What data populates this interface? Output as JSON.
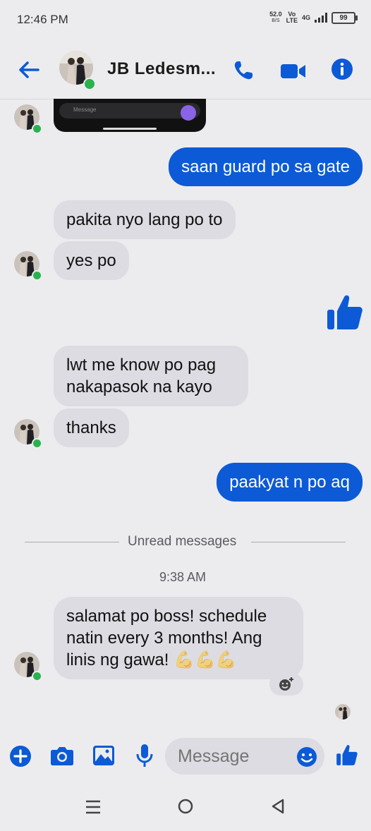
{
  "status_bar": {
    "time": "12:46 PM",
    "speed_value": "52.0",
    "speed_unit": "B/S",
    "volte_top": "Vo",
    "volte_bottom": "LTE",
    "network": "4G",
    "battery": "99"
  },
  "header": {
    "contact_name": "JB Ledesm...",
    "accent_color": "#0c5ad6"
  },
  "image_message": {
    "placeholder": "Message"
  },
  "messages": [
    {
      "direction": "out",
      "text": "saan guard po sa gate"
    },
    {
      "direction": "in",
      "text": "pakita nyo lang po to"
    },
    {
      "direction": "in",
      "text": "yes po"
    },
    {
      "direction": "out",
      "type": "like",
      "icon": "thumbs-up-icon"
    },
    {
      "direction": "in",
      "text": "lwt me know po pag nakapasok na kayo"
    },
    {
      "direction": "in",
      "text": "thanks"
    },
    {
      "direction": "out",
      "text": "paakyat n po aq"
    },
    {
      "direction": "in",
      "text": "salamat po boss! schedule natin every 3 months! Ang linis ng gawa!",
      "emoji": "💪💪💪"
    }
  ],
  "unread_divider": "Unread messages",
  "timestamp": "9:38 AM",
  "composer": {
    "placeholder": "Message"
  },
  "nav": {
    "recent": "recent-apps-icon",
    "home": "home-icon",
    "back": "back-icon"
  }
}
